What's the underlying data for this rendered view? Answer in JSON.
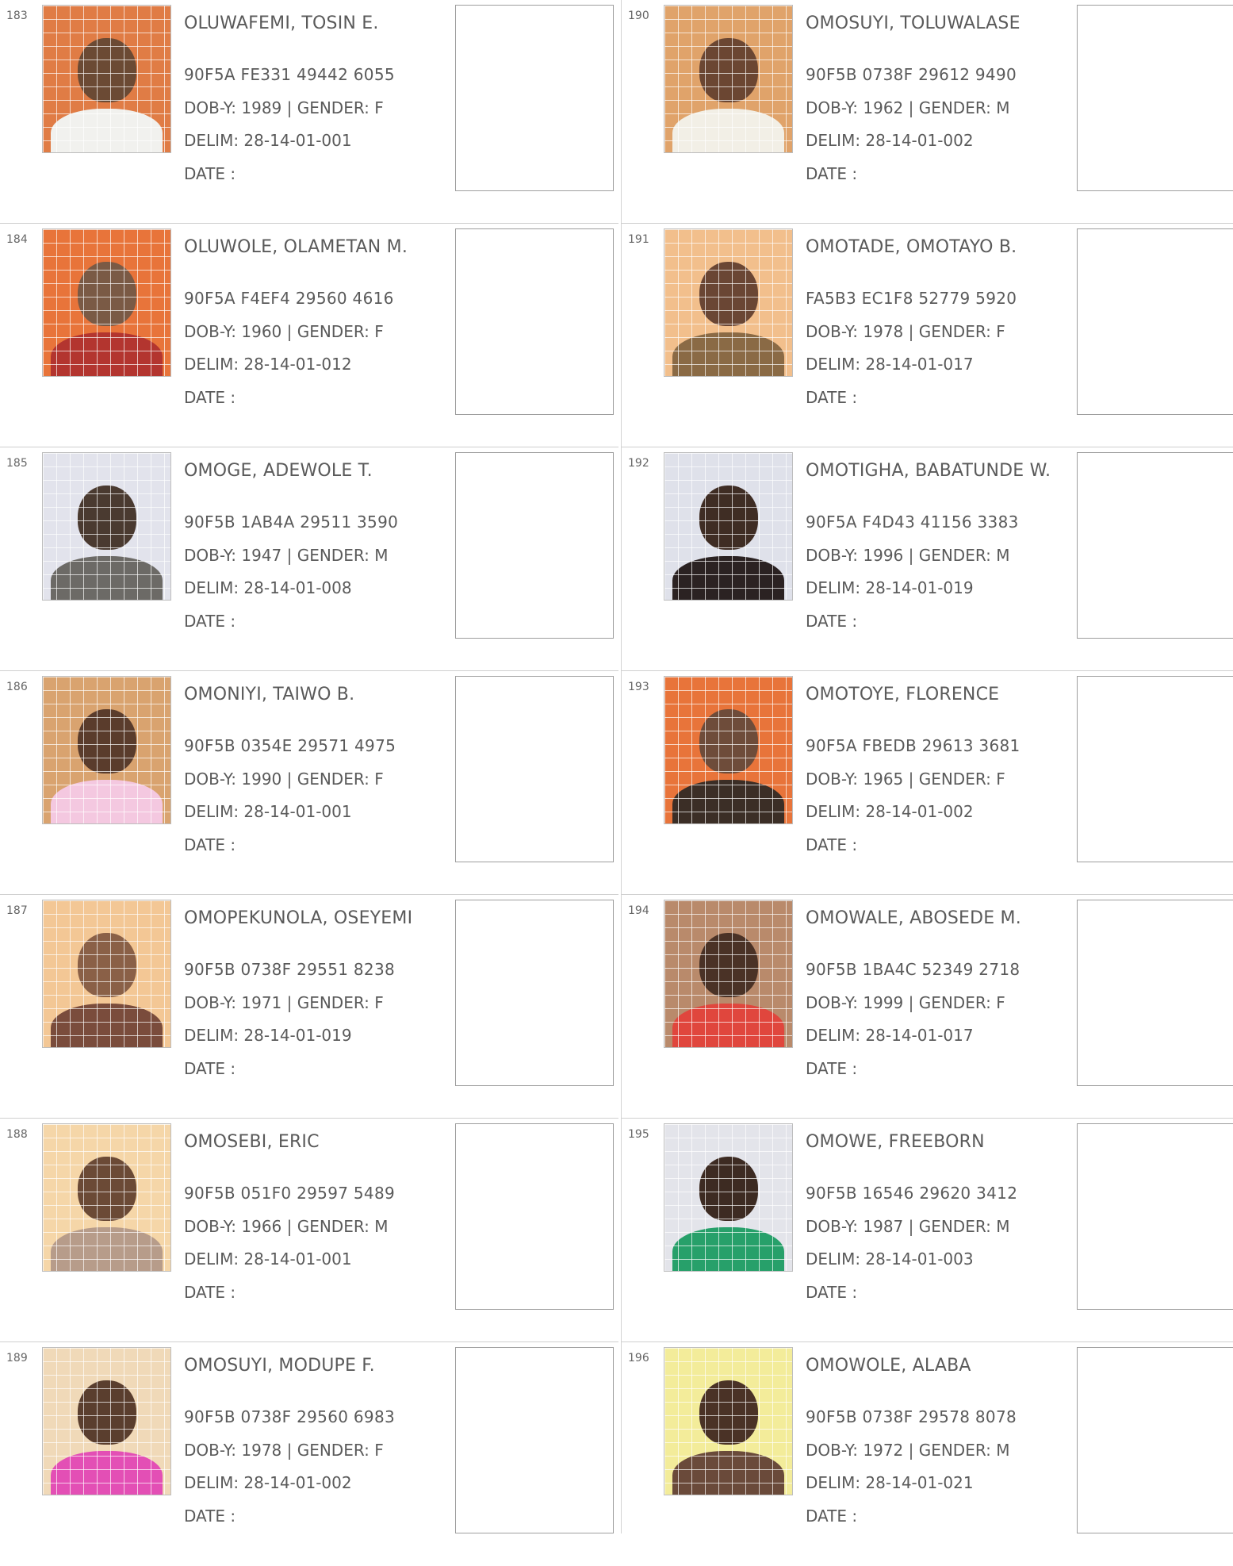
{
  "columns": [
    {
      "entries": [
        {
          "serial": "183",
          "name": "OLUWAFEMI, TOSIN E.",
          "vin": "90F5A FE331 49442 6055",
          "dob": "DOB-Y: 1989  | GENDER: F",
          "delim": "DELIM: 28-14-01-001",
          "date": "DATE  :",
          "photo": {
            "bg": "#e07c45",
            "face": "#6b4a34",
            "cloth": "#f1f1ee"
          }
        },
        {
          "serial": "184",
          "name": "OLUWOLE, OLAMETAN M.",
          "vin": "90F5A F4EF4 29560 4616",
          "dob": "DOB-Y: 1960  | GENDER: F",
          "delim": "DELIM: 28-14-01-012",
          "date": "DATE  :",
          "photo": {
            "bg": "#e8743a",
            "face": "#7a5a45",
            "cloth": "#b3352f"
          }
        },
        {
          "serial": "185",
          "name": "OMOGE, ADEWOLE T.",
          "vin": "90F5B 1AB4A 29511 3590",
          "dob": "DOB-Y: 1947  | GENDER: M",
          "delim": "DELIM: 28-14-01-008",
          "date": "DATE  :",
          "photo": {
            "bg": "#e2e3ec",
            "face": "#4a3a30",
            "cloth": "#6c6a66"
          }
        },
        {
          "serial": "186",
          "name": "OMONIYI, TAIWO B.",
          "vin": "90F5B 0354E 29571 4975",
          "dob": "DOB-Y: 1990  | GENDER: F",
          "delim": "DELIM: 28-14-01-001",
          "date": "DATE  :",
          "photo": {
            "bg": "#d9a36f",
            "face": "#5a3c2c",
            "cloth": "#f4c8e0"
          }
        },
        {
          "serial": "187",
          "name": "OMOPEKUNOLA, OSEYEMI",
          "vin": "90F5B 0738F 29551 8238",
          "dob": "DOB-Y: 1971  | GENDER: F",
          "delim": "DELIM: 28-14-01-019",
          "date": "DATE  :",
          "photo": {
            "bg": "#f3c795",
            "face": "#8a6047",
            "cloth": "#7a4c3c"
          }
        },
        {
          "serial": "188",
          "name": "OMOSEBI, ERIC",
          "vin": "90F5B 051F0 29597 5489",
          "dob": "DOB-Y: 1966  | GENDER: M",
          "delim": "DELIM: 28-14-01-001",
          "date": "DATE  :",
          "photo": {
            "bg": "#f5d6a8",
            "face": "#6b4a36",
            "cloth": "#b79c8a"
          }
        },
        {
          "serial": "189",
          "name": "OMOSUYI, MODUPE F.",
          "vin": "90F5B 0738F 29560 6983",
          "dob": "DOB-Y: 1978  | GENDER: F",
          "delim": "DELIM: 28-14-01-002",
          "date": "DATE  :",
          "photo": {
            "bg": "#f0d9b8",
            "face": "#5a3e2e",
            "cloth": "#e34fb5"
          }
        }
      ]
    },
    {
      "entries": [
        {
          "serial": "190",
          "name": "OMOSUYI, TOLUWALASE",
          "vin": "90F5B 0738F 29612 9490",
          "dob": "DOB-Y: 1962  | GENDER: M",
          "delim": "DELIM: 28-14-01-002",
          "date": "DATE  :",
          "photo": {
            "bg": "#e0a36a",
            "face": "#6b4632",
            "cloth": "#f2efe6"
          }
        },
        {
          "serial": "191",
          "name": "OMOTADE, OMOTAYO B.",
          "vin": "FA5B3 EC1F8 52779 5920",
          "dob": "DOB-Y: 1978  | GENDER: F",
          "delim": "DELIM: 28-14-01-017",
          "date": "DATE  :",
          "photo": {
            "bg": "#f2bf8c",
            "face": "#6a4634",
            "cloth": "#8a6a45"
          }
        },
        {
          "serial": "192",
          "name": "OMOTIGHA, BABATUNDE W.",
          "vin": "90F5A F4D43 41156 3383",
          "dob": "DOB-Y: 1996  | GENDER: M",
          "delim": "DELIM: 28-14-01-019",
          "date": "DATE  :",
          "photo": {
            "bg": "#dfe1ea",
            "face": "#3f2d24",
            "cloth": "#2b2222"
          }
        },
        {
          "serial": "193",
          "name": "OMOTOYE, FLORENCE",
          "vin": "90F5A FBEDB 29613 3681",
          "dob": "DOB-Y: 1965  | GENDER: F",
          "delim": "DELIM: 28-14-01-002",
          "date": "DATE  :",
          "photo": {
            "bg": "#e8743a",
            "face": "#6e4c3a",
            "cloth": "#3b2e26"
          }
        },
        {
          "serial": "194",
          "name": "OMOWALE, ABOSEDE M.",
          "vin": "90F5B 1BA4C 52349 2718",
          "dob": "DOB-Y: 1999  | GENDER: F",
          "delim": "DELIM: 28-14-01-017",
          "date": "DATE  :",
          "photo": {
            "bg": "#b98a6b",
            "face": "#4a3226",
            "cloth": "#e0463d"
          }
        },
        {
          "serial": "195",
          "name": "OMOWE, FREEBORN",
          "vin": "90F5B 16546 29620 3412",
          "dob": "DOB-Y: 1987  | GENDER: M",
          "delim": "DELIM: 28-14-01-003",
          "date": "DATE  :",
          "photo": {
            "bg": "#e3e4ea",
            "face": "#3d2b22",
            "cloth": "#27a06a"
          }
        },
        {
          "serial": "196",
          "name": "OMOWOLE, ALABA",
          "vin": "90F5B 0738F 29578 8078",
          "dob": "DOB-Y: 1972  | GENDER: M",
          "delim": "DELIM: 28-14-01-021",
          "date": "DATE  :",
          "photo": {
            "bg": "#f3ec9a",
            "face": "#4a3226",
            "cloth": "#6a4a3a"
          }
        }
      ]
    }
  ]
}
